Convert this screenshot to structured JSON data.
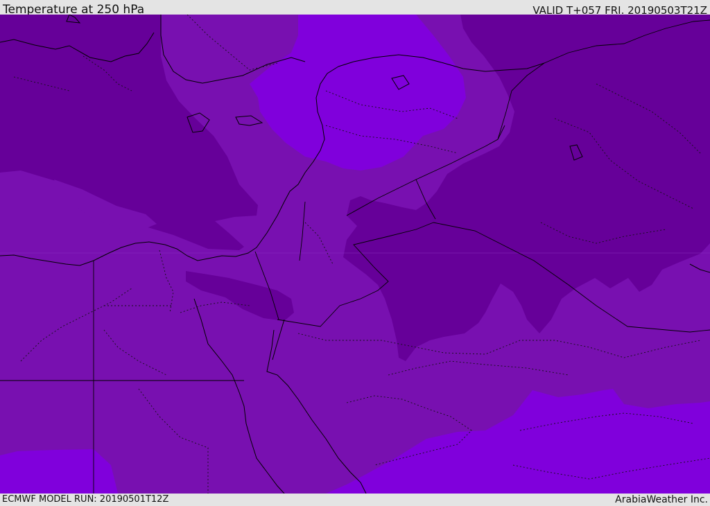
{
  "header": {
    "title": "Temperature at 250 hPa",
    "valid": "VALID T+057 FRI. 20190503T21Z"
  },
  "footer": {
    "model_run": "ECMWF MODEL RUN: 20190501T12Z",
    "credit": "ArabiaWeather Inc."
  },
  "map": {
    "field": "temperature",
    "pressure_level": "250 hPa",
    "colors": {
      "background": "#7810b0",
      "cold": "#660099",
      "warm": "#8000dc"
    }
  }
}
